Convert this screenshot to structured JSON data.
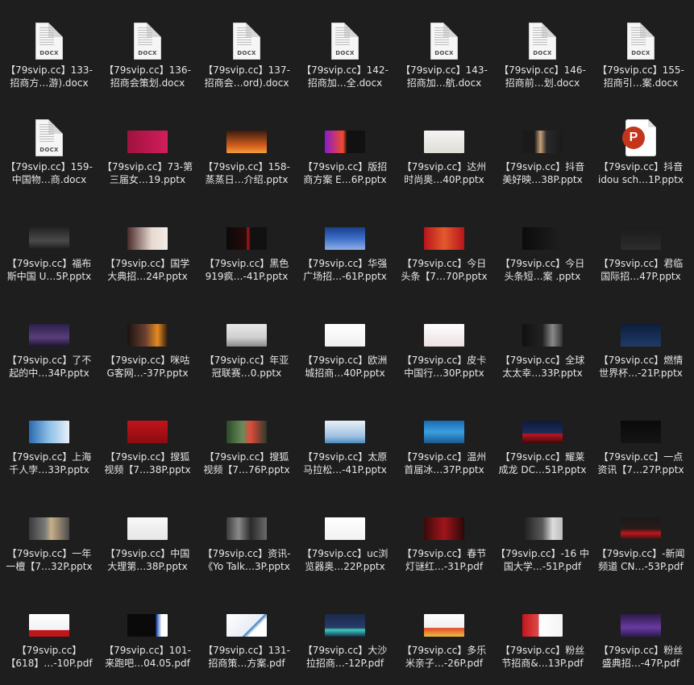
{
  "files": [
    {
      "l1": "【79svip.cc】133-",
      "l2": "招商方…游).docx",
      "kind": "docx",
      "tag": "DOCX"
    },
    {
      "l1": "【79svip.cc】136-",
      "l2": "招商会策划.docx",
      "kind": "docx",
      "tag": "DOCX"
    },
    {
      "l1": "【79svip.cc】137-",
      "l2": "招商会…ord).docx",
      "kind": "docx",
      "tag": "DOCX"
    },
    {
      "l1": "【79svip.cc】142-",
      "l2": "招商加…全.docx",
      "kind": "docx",
      "tag": "DOCX"
    },
    {
      "l1": "【79svip.cc】143-",
      "l2": "招商加…航.docx",
      "kind": "docx",
      "tag": "DOCX"
    },
    {
      "l1": "【79svip.cc】146-",
      "l2": "招商前…划.docx",
      "kind": "docx",
      "tag": "DOCX"
    },
    {
      "l1": "【79svip.cc】155-",
      "l2": "招商引…案.docx",
      "kind": "docx",
      "tag": "DOCX"
    },
    {
      "l1": "【79svip.cc】159-",
      "l2": "中国物…商.docx",
      "kind": "docx",
      "tag": "DOCX"
    },
    {
      "l1": "【79svip.cc】73-第",
      "l2": "三届女…19.pptx",
      "kind": "slide",
      "bg": "linear-gradient(90deg,#a0123e,#d11e5d)"
    },
    {
      "l1": "【79svip.cc】158-",
      "l2": "蒸蒸日…介绍.pptx",
      "kind": "slide",
      "bg": "linear-gradient(180deg,#3a1a10,#d9621c 70%,#f0a040)"
    },
    {
      "l1": "【79svip.cc】版招",
      "l2": "商方案 E…6P.pptx",
      "kind": "slide",
      "bg": "linear-gradient(90deg,#8a1bd0,#f04a2a 45%,#111 55%,#111)"
    },
    {
      "l1": "【79svip.cc】达州",
      "l2": "时尚奥…40P.pptx",
      "kind": "slide",
      "bg": "linear-gradient(180deg,#f4f4f4,#e0ddd6)"
    },
    {
      "l1": "【79svip.cc】抖音",
      "l2": "美好映…38P.pptx",
      "kind": "slide",
      "bg": "linear-gradient(90deg,#1a1a1a 30%,#c7a27a 45%,#2a2a2a 60%,#1a1a1a)"
    },
    {
      "l1": "【79svip.cc】抖音",
      "l2": "idou sch…1P.pptx",
      "kind": "ppt",
      "letter": "P"
    },
    {
      "l1": "【79svip.cc】福布",
      "l2": "斯中国 U…5P.pptx",
      "kind": "slide",
      "bg": "linear-gradient(180deg,#222 0,#4a4a4a 60%,#1a1a1a)"
    },
    {
      "l1": "【79svip.cc】国学",
      "l2": "大典招…24P.pptx",
      "kind": "slide",
      "bg": "linear-gradient(90deg,#4a2b2b,#e8d8d0 60%,#f2ece8)"
    },
    {
      "l1": "【79svip.cc】黑色",
      "l2": "919疯…-41P.pptx",
      "kind": "slide",
      "bg": "linear-gradient(90deg,#0a0a0a,#2a0a0a 50%,#c0191b 52%,#111 60%)"
    },
    {
      "l1": "【79svip.cc】华强",
      "l2": "广场招…-61P.pptx",
      "kind": "slide",
      "bg": "linear-gradient(180deg,#1a3e8a,#3d6fc9 50%,#8fb0e8)"
    },
    {
      "l1": "【79svip.cc】今日",
      "l2": "头条【7…70P.pptx",
      "kind": "slide",
      "bg": "linear-gradient(90deg,#b8141b,#e25a2c 50%,#b8141b)"
    },
    {
      "l1": "【79svip.cc】今日",
      "l2": "头条短…案 .pptx",
      "kind": "slide",
      "bg": "linear-gradient(90deg,#0b0b0b,#1f1f1f)"
    },
    {
      "l1": "【79svip.cc】君临",
      "l2": "国际招…47P.pptx",
      "kind": "slide",
      "bg": "linear-gradient(180deg,#1b1b1b,#2d2d2d)"
    },
    {
      "l1": "【79svip.cc】了不",
      "l2": "起的中…34P.pptx",
      "kind": "slide",
      "bg": "linear-gradient(180deg,#2a1f4a,#5a3e7a 60%,#1a1430)"
    },
    {
      "l1": "【79svip.cc】咪咕",
      "l2": "G客网…-37P.pptx",
      "kind": "slide",
      "bg": "linear-gradient(90deg,#1a1210,#6a4030 45%,#e48a20 75%,#2a1a10)"
    },
    {
      "l1": "【79svip.cc】年亚",
      "l2": "冠联赛…0.pptx",
      "kind": "slide",
      "bg": "linear-gradient(180deg,#e8e8e8,#cfcfcf 60%,#8a8a8a)"
    },
    {
      "l1": "【79svip.cc】欧洲",
      "l2": "城招商…40P.pptx",
      "kind": "slide",
      "bg": "linear-gradient(180deg,#ffffff,#f0f0f0)"
    },
    {
      "l1": "【79svip.cc】皮卡",
      "l2": "中国行…30P.pptx",
      "kind": "slide",
      "bg": "linear-gradient(180deg,#ffffff,#ecdfdf)"
    },
    {
      "l1": "【79svip.cc】全球",
      "l2": "太太幸…33P.pptx",
      "kind": "slide",
      "bg": "linear-gradient(90deg,#111,#222 50%,#8a8a8a 75%,#333)"
    },
    {
      "l1": "【79svip.cc】燃情",
      "l2": "世界杯…-21P.pptx",
      "kind": "slide",
      "bg": "linear-gradient(180deg,#0d1e3a,#1f3a6a)"
    },
    {
      "l1": "【79svip.cc】上海",
      "l2": "千人孛…33P.pptx",
      "kind": "slide",
      "bg": "linear-gradient(90deg,#2a6ab0,#8ec0e8 50%,#e8f0f8)"
    },
    {
      "l1": "【79svip.cc】搜狐",
      "l2": "视频【7…38P.pptx",
      "kind": "slide",
      "bg": "linear-gradient(180deg,#c0151b,#8a0c10)"
    },
    {
      "l1": "【79svip.cc】搜狐",
      "l2": "视频【7…76P.pptx",
      "kind": "slide",
      "bg": "linear-gradient(90deg,#2a4a2a,#6a8a5a 40%,#e04a3a 60%,#2a3a2a)"
    },
    {
      "l1": "【79svip.cc】太原",
      "l2": "马拉松…-41P.pptx",
      "kind": "slide",
      "bg": "linear-gradient(180deg,#e8f0f8,#9ec0e0 70%,#4a8ac0)"
    },
    {
      "l1": "【79svip.cc】温州",
      "l2": "首届冰…37P.pptx",
      "kind": "slide",
      "bg": "linear-gradient(180deg,#1a6ab0,#3aa0e0 50%,#1a5a90)"
    },
    {
      "l1": "【79svip.cc】耀莱",
      "l2": "成龙 DC…51P.pptx",
      "kind": "slide",
      "bg": "linear-gradient(180deg,#0e1a3a,#1c2c5a 55%,#c0151b 60%,#3a0a10)"
    },
    {
      "l1": "【79svip.cc】一点",
      "l2": "资讯【7…27P.pptx",
      "kind": "slide",
      "bg": "linear-gradient(180deg,#0a0a0a,#141414)"
    },
    {
      "l1": "【79svip.cc】一年",
      "l2": "一檀【7…32P.pptx",
      "kind": "slide",
      "bg": "linear-gradient(90deg,#3a3a3a,#7a7a7a 40%,#c8b08a 55%,#4a4a4a)"
    },
    {
      "l1": "【79svip.cc】中国",
      "l2": "大理第…38P.pptx",
      "kind": "slide",
      "bg": "linear-gradient(180deg,#f8f8f8,#e6e6e6)"
    },
    {
      "l1": "【79svip.cc】资讯-",
      "l2": "《Yo Talk…3P.pptx",
      "kind": "slide",
      "bg": "linear-gradient(90deg,#3a3a3a,#8a8a8a 30%,#2a2a2a 60%,#6a6a6a)"
    },
    {
      "l1": "【79svip.cc】uc浏",
      "l2": "览器奥…22P.pptx",
      "kind": "slide",
      "bg": "linear-gradient(180deg,#ffffff,#f2f2f2)"
    },
    {
      "l1": "【79svip.cc】春节",
      "l2": "灯谜红…-31P.pdf",
      "kind": "slide",
      "bg": "linear-gradient(90deg,#3a0a0a,#a0151b 50%,#2a0808)"
    },
    {
      "l1": "【79svip.cc】-16 中",
      "l2": "国大学…-51P.pdf",
      "kind": "slide",
      "bg": "linear-gradient(90deg,#1a1a1a,#5a5a5a 50%,#dcdcdc 75%,#bdbdbd)"
    },
    {
      "l1": "【79svip.cc】-新闻",
      "l2": "频道 CN…-53P.pdf",
      "kind": "slide",
      "bg": "linear-gradient(180deg,#1a1a1a,#2a1a1a 50%,#c0151b 70%,#1a1a1a)"
    },
    {
      "l1": "【79svip.cc】",
      "l2": "【618】…-10P.pdf",
      "kind": "slide",
      "bg": "linear-gradient(180deg,#ffffff,#f2f2f2 70%,#c0151b 72%,#c0151b)"
    },
    {
      "l1": "【79svip.cc】101-",
      "l2": "来跑吧…04.05.pdf",
      "kind": "slide",
      "bg": "linear-gradient(90deg,#0a0a0a 70%,#1a4ab0 72%,#ffffff 85%)"
    },
    {
      "l1": "【79svip.cc】131-",
      "l2": "招商策…方案.pdf",
      "kind": "slide",
      "bg": "linear-gradient(135deg,#ffffff,#e8eef6 60%,#3a7ac0 62%,#ffffff 70%)"
    },
    {
      "l1": "【79svip.cc】大沙",
      "l2": "拉招商…-12P.pdf",
      "kind": "slide",
      "bg": "linear-gradient(180deg,#1a2a4a,#2a3a6a 60%,#3ad0c0 70%,#1a2a4a)"
    },
    {
      "l1": "【79svip.cc】多乐",
      "l2": "米亲子…-26P.pdf",
      "kind": "slide",
      "bg": "linear-gradient(180deg,#ffffff,#f0f0f0 60%,#e04a2a 62%,#f0c040)"
    },
    {
      "l1": "【79svip.cc】粉丝",
      "l2": "节招商&…13P.pdf",
      "kind": "slide",
      "bg": "linear-gradient(90deg,#c0151b,#e04a4a 40%,#ffffff 42%,#f4f4f4)"
    },
    {
      "l1": "【79svip.cc】粉丝",
      "l2": "盛典招…-47P.pdf",
      "kind": "slide",
      "bg": "linear-gradient(180deg,#2a1a4a,#6a3aa0 60%,#2a1a4a)"
    }
  ]
}
